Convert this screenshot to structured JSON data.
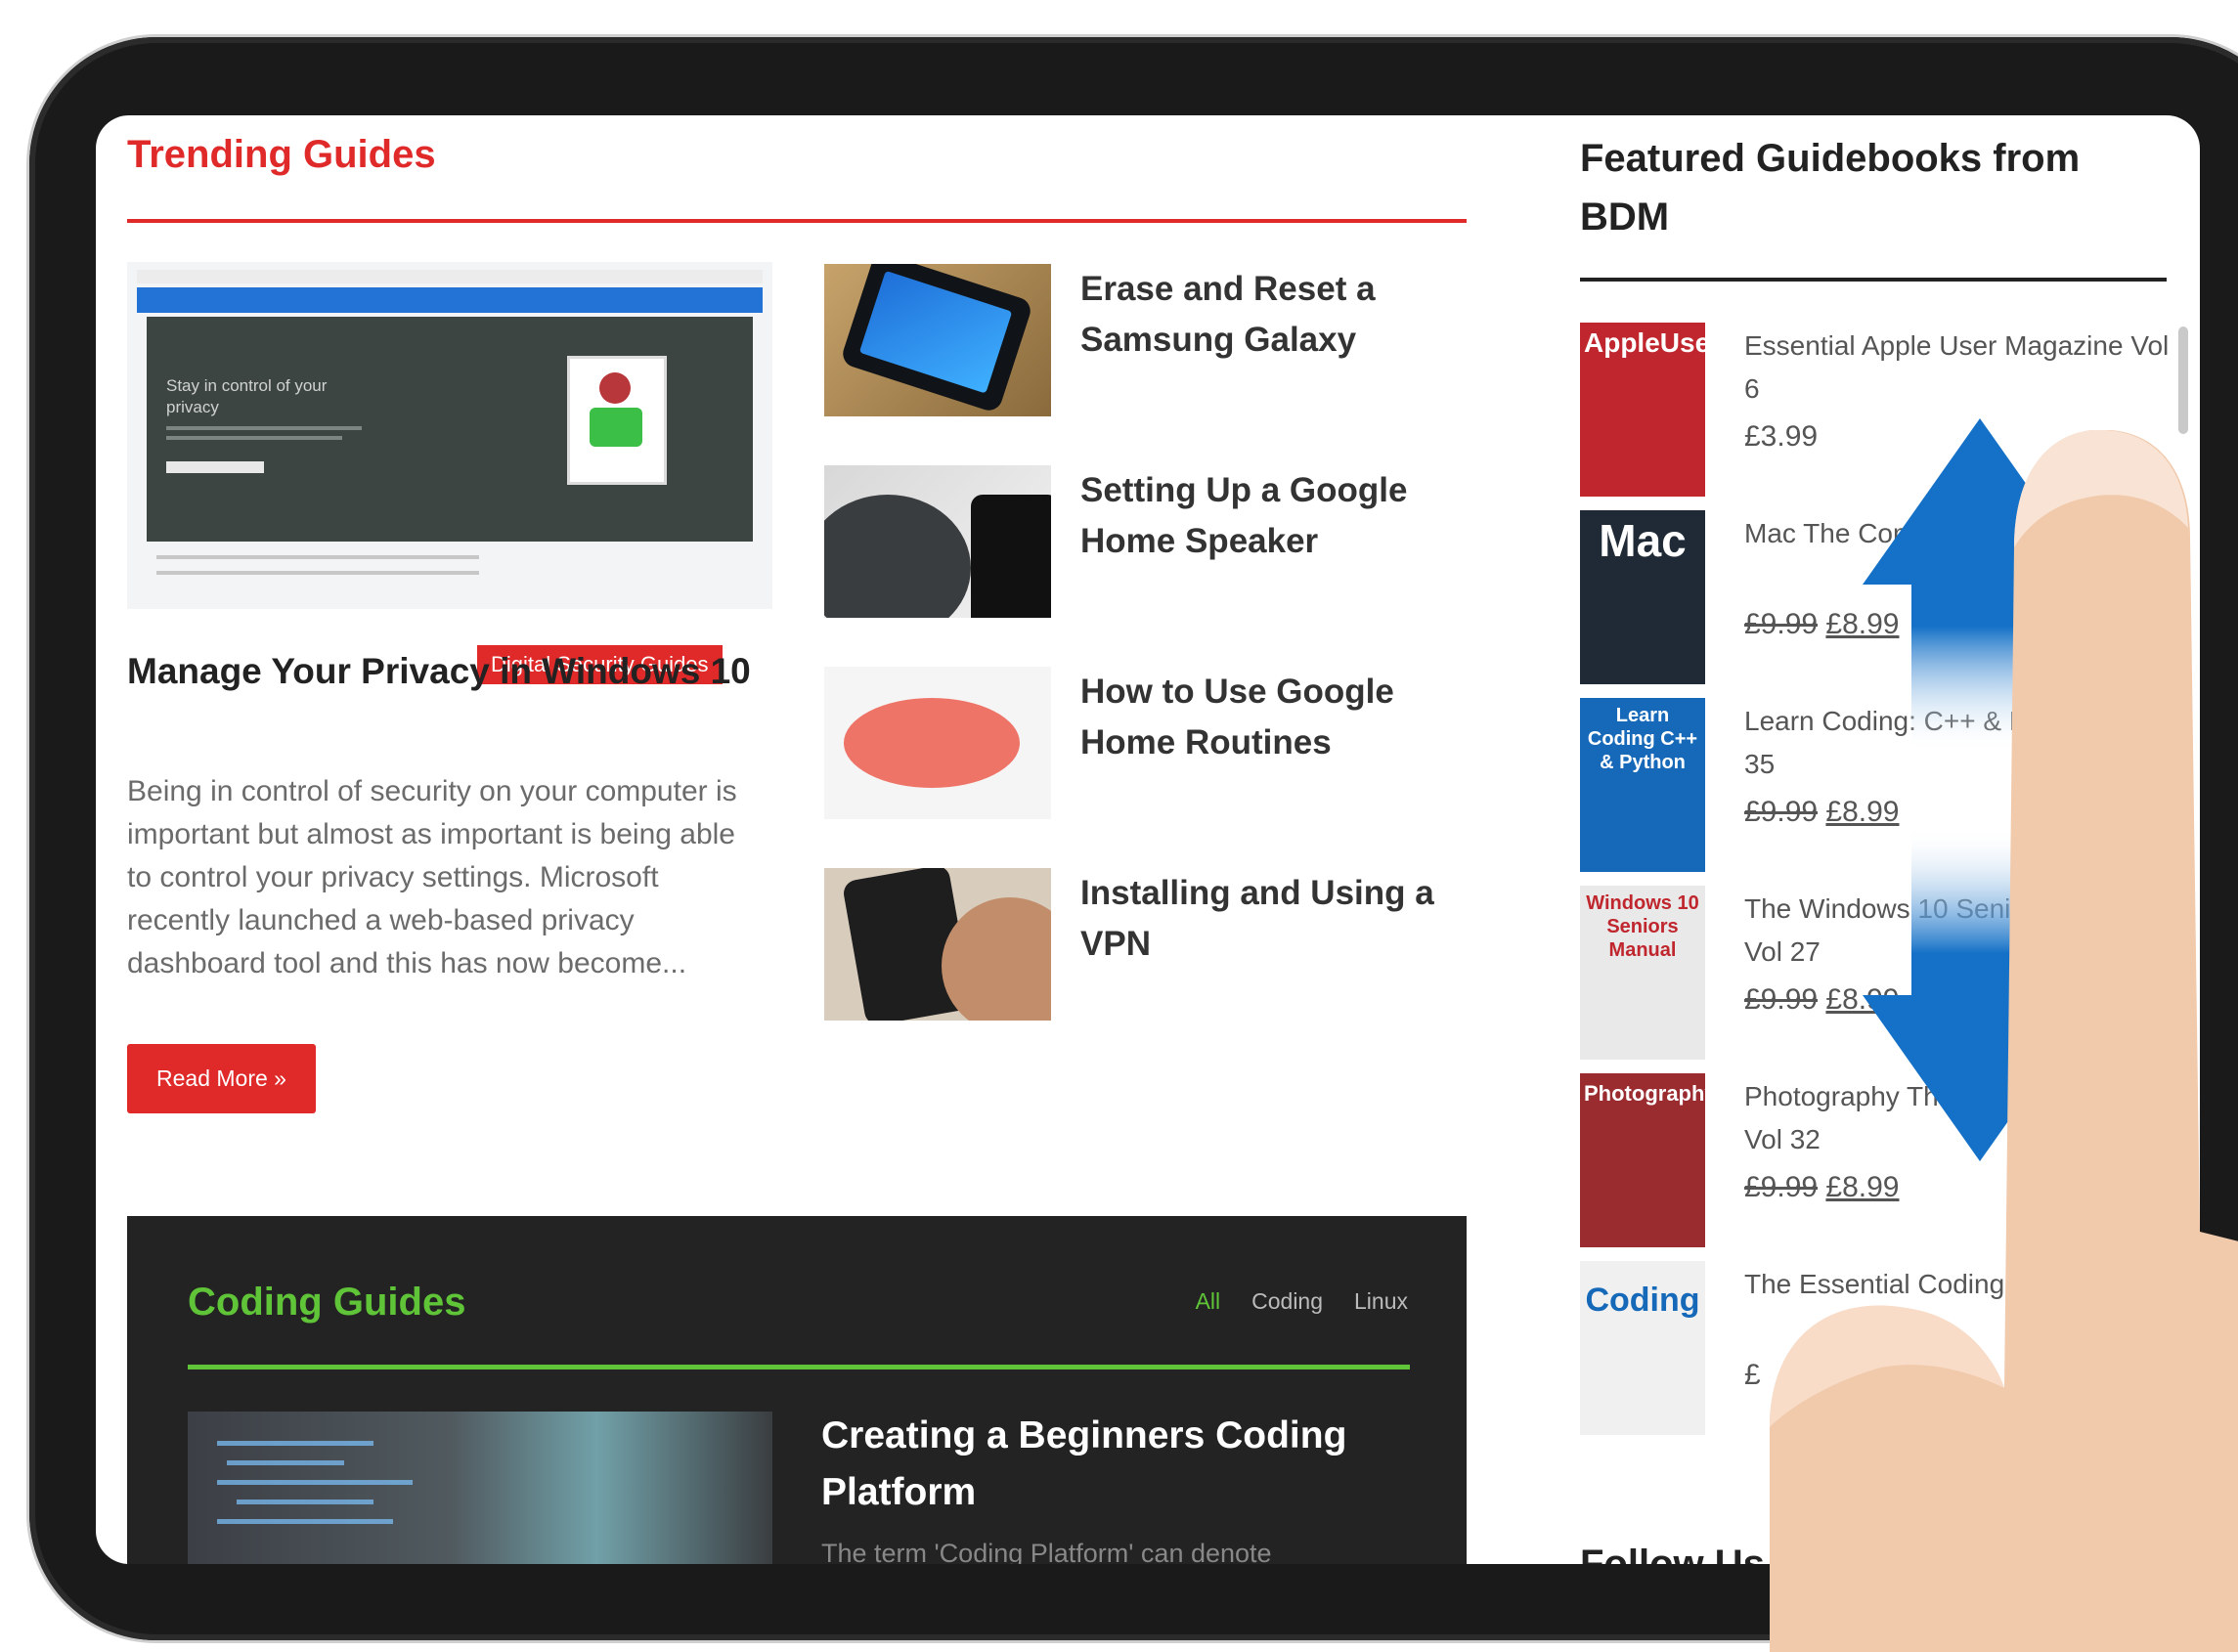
{
  "trending": {
    "title": "Trending Guides",
    "hero": {
      "badge": "Digital Security Guides",
      "image_text": "Stay in control of your privacy",
      "title": "Manage Your Privacy in Windows 10",
      "excerpt": "Being in control of security on your computer is important but almost as important is being able to control your privacy settings. Microsoft recently launched a web-based privacy dashboard tool and this has now become...",
      "read_more": "Read More »"
    },
    "items": [
      {
        "label": "Erase and Reset a Samsung Galaxy"
      },
      {
        "label": "Setting Up a Google Home Speaker"
      },
      {
        "label": "How to Use Google Home Routines"
      },
      {
        "label": "Installing and Using a VPN"
      }
    ]
  },
  "coding": {
    "title": "Coding Guides",
    "tabs": [
      "All",
      "Coding",
      "Linux"
    ],
    "post_title": "Creating a Beginners Coding Platform",
    "post_excerpt": "The term 'Coding Platform' can denote"
  },
  "sidebar": {
    "title": "Featured Guidebooks from BDM",
    "books": [
      {
        "name": "Essential Apple User Magazine Vol 6",
        "price": "£3.99",
        "old_price": "",
        "cover": "AppleUser",
        "cover_color": "#c0262d"
      },
      {
        "name": "Mac The Complete Guide 32",
        "price": "£8.99",
        "old_price": "£9.99",
        "cover": "Mac",
        "cover_color": "#1f2a36"
      },
      {
        "name": "Learn Coding: C++ & Python Vol 35",
        "price": "£8.99",
        "old_price": "£9.99",
        "cover": "Learn Coding C++ & Python",
        "cover_color": "#1569b8"
      },
      {
        "name": "The Windows 10 Seniors Manual Vol 27",
        "price": "£8.99",
        "old_price": "£9.99",
        "cover": "Windows 10 Seniors Manual",
        "cover_color": "#e9e9e9"
      },
      {
        "name": "Photography The Beginner's Guide Vol 32",
        "price": "£8.99",
        "old_price": "£9.99",
        "cover": "Photography",
        "cover_color": "#9a2b2f"
      },
      {
        "name": "The Essential Coding Manual Vol",
        "price": "£",
        "old_price": "",
        "cover": "Coding",
        "cover_color": "#f0f0f0"
      }
    ],
    "follow_title": "Follow Us"
  },
  "colors": {
    "accent_red": "#e02a2a",
    "accent_green": "#5fc438",
    "dark_block": "#232323",
    "gesture_blue": "#1571c7"
  }
}
